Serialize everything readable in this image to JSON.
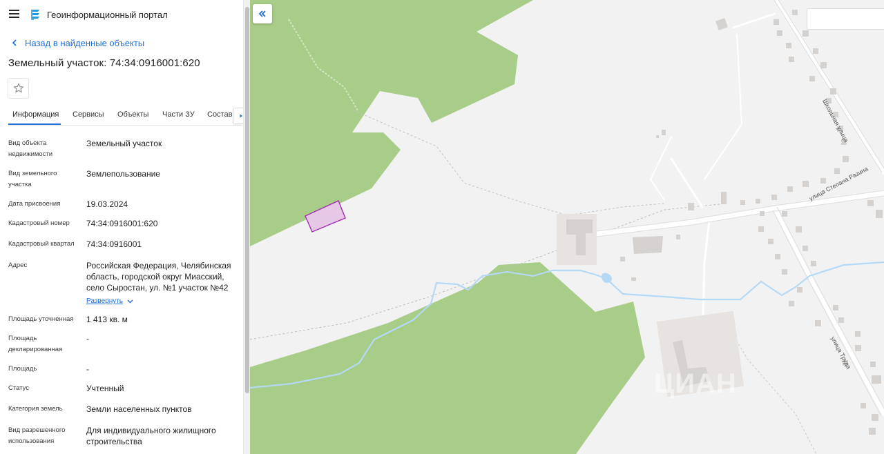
{
  "app": {
    "title": "Геоинформационный портал"
  },
  "nav": {
    "back_label": "Назад в найденные объекты"
  },
  "object": {
    "title": "Земельный участок: 74:34:0916001:620"
  },
  "tabs": [
    {
      "label": "Информация",
      "active": true
    },
    {
      "label": "Сервисы"
    },
    {
      "label": "Объекты"
    },
    {
      "label": "Части ЗУ"
    },
    {
      "label": "Состав"
    }
  ],
  "info": {
    "rows": [
      {
        "label": "Вид объекта недвижимости",
        "value": "Земельный участок"
      },
      {
        "label": "Вид земельного участка",
        "value": "Землепользование"
      },
      {
        "label": "Дата присвоения",
        "value": "19.03.2024"
      },
      {
        "label": "Кадастровый номер",
        "value": "74:34:0916001:620"
      },
      {
        "label": "Кадастровый квартал",
        "value": "74:34:0916001"
      },
      {
        "label": "Адрес",
        "value": "Российская Федерация, Челябинская область, городской округ Миасский, село Сыростан, ул. №1 участок №42"
      },
      {
        "label": "Площадь уточненная",
        "value": "1 413 кв. м"
      },
      {
        "label": "Площадь декларированная",
        "value": "-"
      },
      {
        "label": "Площадь",
        "value": "-"
      },
      {
        "label": "Статус",
        "value": "Учтенный"
      },
      {
        "label": "Категория земель",
        "value": "Земли населенных пунктов"
      },
      {
        "label": "Вид разрешенного использования",
        "value": "Для индивидуального жилищного строительства"
      }
    ],
    "expand_label": "Развернуть"
  },
  "map": {
    "streets": [
      {
        "name": "Школьная улица"
      },
      {
        "name": "улица Степана Разина"
      },
      {
        "name": "улица Труда"
      }
    ],
    "watermark": "ЦИАН",
    "colors": {
      "forest": "#a8cd88",
      "land": "#f2f2f2",
      "water": "#b5d9f5",
      "parcel_fill": "#e6c7e6",
      "parcel_stroke": "#a02eb0",
      "building": "#d5d1ce",
      "accent": "#1e6fd9"
    }
  }
}
